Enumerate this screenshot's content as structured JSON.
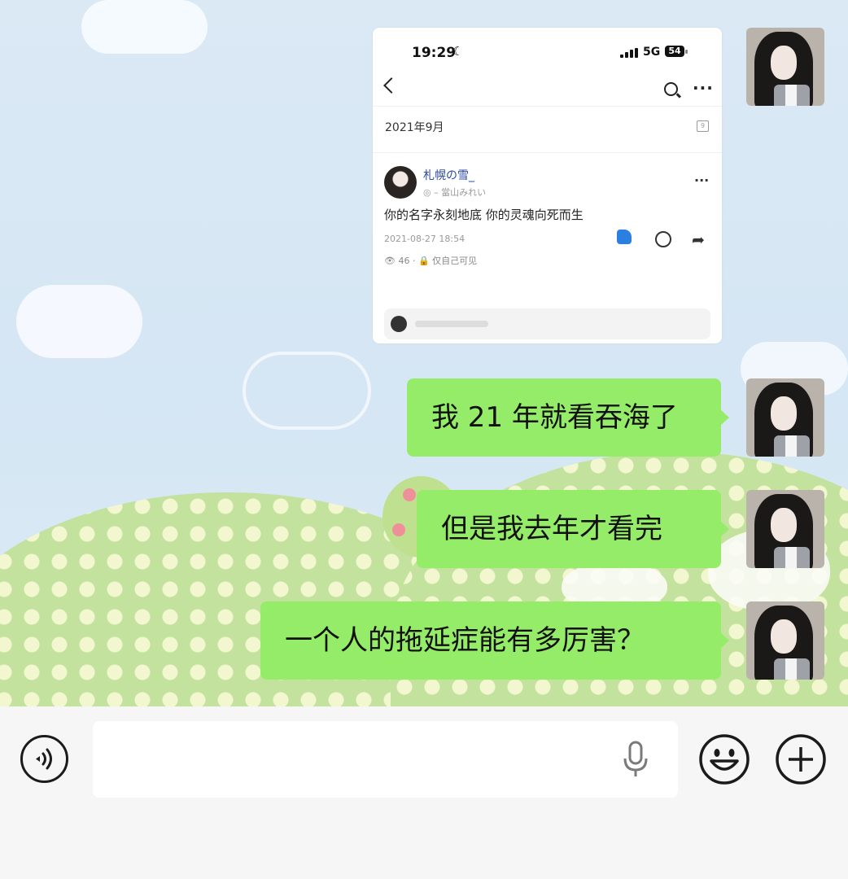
{
  "shared_screenshot": {
    "status_time": "19:29",
    "moon_glyph": "☾",
    "network": "5G",
    "battery": "54",
    "date_header": "2021年9月",
    "calendar_day": "9",
    "post": {
      "author": "札幌の雪_",
      "subtitle": "◎ – 當山みれい",
      "text": "你的名字永刻地底 你的灵魂向死而生",
      "timestamp": "2021-08-27 18:54",
      "views": "👁 46 · 🔒 仅自己可见",
      "more": "···"
    },
    "more_glyph": "···",
    "share_glyph": "➦"
  },
  "messages": [
    {
      "text": "我 21 年就看吞海了"
    },
    {
      "text": "但是我去年才看完"
    },
    {
      "text": "一个人的拖延症能有多厉害？"
    }
  ],
  "input_bar": {
    "value": "",
    "placeholder": "",
    "icons": [
      "voice-icon",
      "microphone-icon",
      "emoji-icon",
      "plus-icon"
    ]
  },
  "colors": {
    "bubble": "#95ec69",
    "link_name": "#2e4aa8",
    "like_blue": "#2b7fe0",
    "input_bg": "#f6f6f6"
  }
}
